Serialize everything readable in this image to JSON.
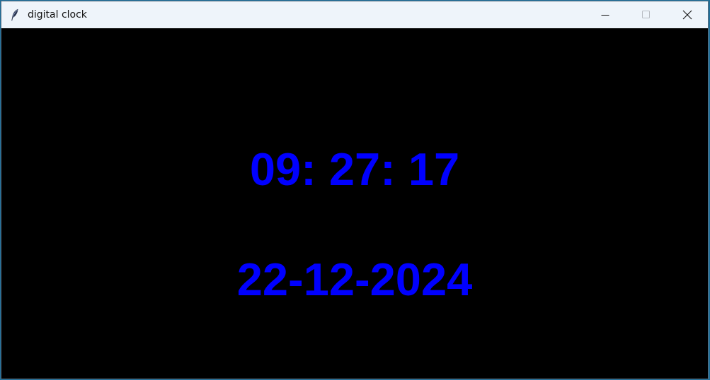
{
  "window": {
    "title": "digital clock",
    "icon": "tk-feather-icon"
  },
  "controls": {
    "minimize_icon": "minimize-icon",
    "maximize_icon": "maximize-icon",
    "close_icon": "close-icon"
  },
  "clock": {
    "time": "09: 27: 17",
    "date": "22-12-2024"
  },
  "colors": {
    "background": "#000000",
    "text": "#0000ff",
    "titlebar": "#eef4fa"
  }
}
